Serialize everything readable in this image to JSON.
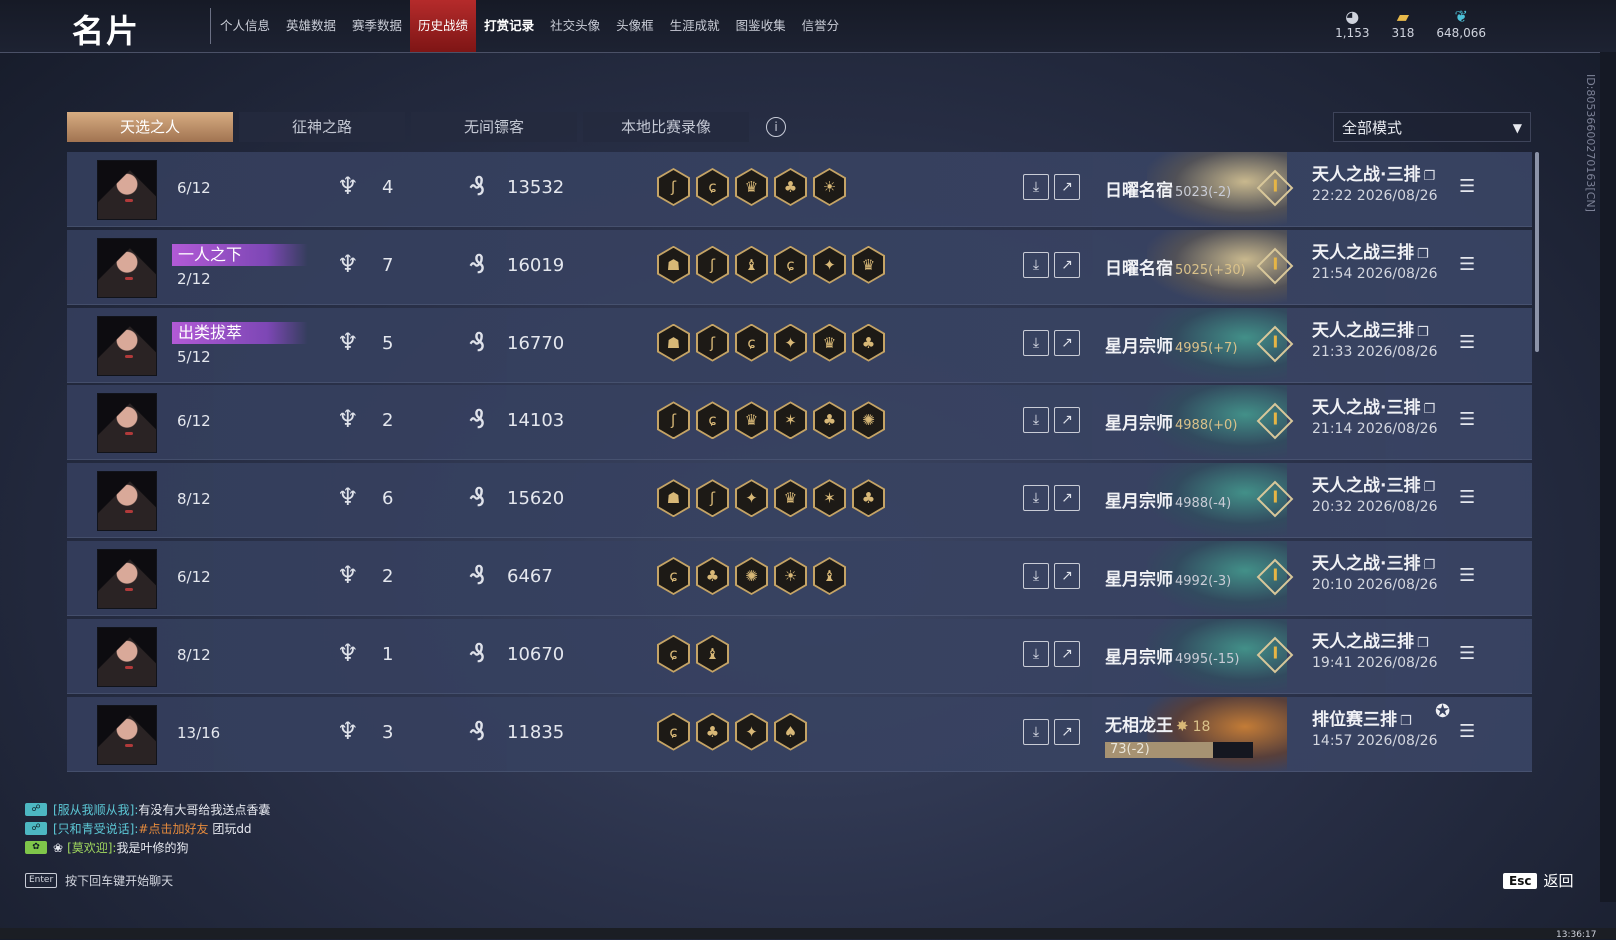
{
  "page_title": "名片",
  "nav_tabs": [
    "个人信息",
    "英雄数据",
    "赛季数据",
    "历史战绩",
    "打赏记录",
    "社交头像",
    "头像框",
    "生涯成就",
    "图鉴收集",
    "信誉分"
  ],
  "active_tab": "历史战绩",
  "currencies": [
    {
      "icon": "eye-coin-icon",
      "value": "1,153"
    },
    {
      "icon": "ticket-icon",
      "value": "318"
    },
    {
      "icon": "feather-icon",
      "value": "648,066"
    }
  ],
  "side_id": "ID:80536600270163[CN]",
  "sub_tabs": [
    "天选之人",
    "征神之路",
    "无间镖客",
    "本地比赛录像"
  ],
  "active_sub_tab": "天选之人",
  "mode_filter": "全部模式",
  "matches": [
    {
      "title_badge": "",
      "placement": "6/12",
      "level": "4",
      "coins": "13532",
      "traits": [
        "ʃ",
        "ɕ",
        "♛",
        "♣",
        "☀"
      ],
      "rank_name": "日曜名宿",
      "rank_change": "5023(-2)",
      "rank_change_color": "gray",
      "rank_bg": "gold",
      "mode": "天人之战·三排",
      "time": "22:22  2026/08/26"
    },
    {
      "title_badge": "一人之下",
      "placement": "2/12",
      "level": "7",
      "coins": "16019",
      "traits": [
        "☗",
        "ʃ",
        "♝",
        "ɕ",
        "✦",
        "♛"
      ],
      "rank_name": "日曜名宿",
      "rank_change": "5025(+30)",
      "rank_change_color": "gold",
      "rank_bg": "gold",
      "mode": "天人之战三排",
      "time": "21:54  2026/08/26"
    },
    {
      "title_badge": "出类拔萃",
      "placement": "5/12",
      "level": "5",
      "coins": "16770",
      "traits": [
        "☗",
        "ʃ",
        "ɕ",
        "✦",
        "♛",
        "♣"
      ],
      "rank_name": "星月宗师",
      "rank_change": "4995(+7)",
      "rank_change_color": "gold",
      "rank_bg": "teal",
      "mode": "天人之战三排",
      "time": "21:33  2026/08/26"
    },
    {
      "title_badge": "",
      "placement": "6/12",
      "level": "2",
      "coins": "14103",
      "traits": [
        "ʃ",
        "ɕ",
        "♛",
        "✶",
        "♣",
        "✺"
      ],
      "rank_name": "星月宗师",
      "rank_change": "4988(+0)",
      "rank_change_color": "gold",
      "rank_bg": "teal",
      "mode": "天人之战·三排",
      "time": "21:14  2026/08/26"
    },
    {
      "title_badge": "",
      "placement": "8/12",
      "level": "6",
      "coins": "15620",
      "traits": [
        "☗",
        "ʃ",
        "✦",
        "♛",
        "✶",
        "♣"
      ],
      "rank_name": "星月宗师",
      "rank_change": "4988(-4)",
      "rank_change_color": "gray",
      "rank_bg": "teal",
      "mode": "天人之战·三排",
      "time": "20:32  2026/08/26"
    },
    {
      "title_badge": "",
      "placement": "6/12",
      "level": "2",
      "coins": "6467",
      "traits": [
        "ɕ",
        "♣",
        "✺",
        "☀",
        "♝"
      ],
      "rank_name": "星月宗师",
      "rank_change": "4992(-3)",
      "rank_change_color": "gray",
      "rank_bg": "teal",
      "mode": "天人之战·三排",
      "time": "20:10  2026/08/26"
    },
    {
      "title_badge": "",
      "placement": "8/12",
      "level": "1",
      "coins": "10670",
      "traits": [
        "ɕ",
        "♝"
      ],
      "rank_name": "星月宗师",
      "rank_change": "4995(-15)",
      "rank_change_color": "gray",
      "rank_bg": "teal",
      "mode": "天人之战三排",
      "time": "19:41  2026/08/26"
    }
  ],
  "last_match": {
    "placement": "13/16",
    "level": "3",
    "coins": "11835",
    "traits": [
      "ɕ",
      "♣",
      "✦",
      "♠"
    ],
    "rank_name": "无相龙王",
    "rank_number": "18",
    "progress_label": "73(-2)",
    "progress_fraction": 0.73,
    "mode": "排位赛三排",
    "time": "14:57  2026/08/26"
  },
  "chat": {
    "messages": [
      {
        "tag": "tag-icon",
        "name": "[服从我顺从我]:",
        "text": "有没有大哥给我送点香囊",
        "link": ""
      },
      {
        "tag": "tag-icon",
        "name": "[只和青受说话]:",
        "text": "团玩dd",
        "link": "#点击加好友"
      },
      {
        "tag": "tag-icon",
        "name": "[莫欢迎]:",
        "text": "我是叶修的狗",
        "link": ""
      }
    ],
    "enter_key": "Enter",
    "hint": "按下回车键开始聊天"
  },
  "esc_key": "Esc",
  "back_label": "返回",
  "clock": "13:36:17"
}
